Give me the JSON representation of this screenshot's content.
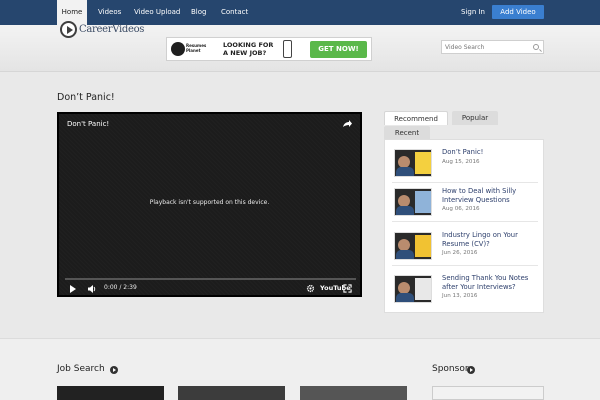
{
  "nav": {
    "items": [
      {
        "label": "Home",
        "active": true
      },
      {
        "label": "Videos",
        "active": false
      },
      {
        "label": "Video Upload",
        "active": false
      },
      {
        "label": "Blog",
        "active": false
      },
      {
        "label": "Contact",
        "active": false
      }
    ],
    "sign_in": "Sign In",
    "add_video": "Add Video"
  },
  "header": {
    "logo_text": "CareerVideos",
    "search_placeholder": "Video Search",
    "ad": {
      "brand": "Resumes Planet",
      "headline": "LOOKING FOR A NEW JOB?",
      "cta": "GET NOW!"
    }
  },
  "main": {
    "page_title": "Don’t Panic!",
    "player": {
      "title": "Don't Panic!",
      "message": "Playback isn't supported on this device.",
      "time": "0:00 / 2:39",
      "progress": 0,
      "logo": "YouTube"
    }
  },
  "sidebar": {
    "tabs": [
      {
        "label": "Recommend",
        "active": true
      },
      {
        "label": "Popular",
        "active": false
      },
      {
        "label": "Recent",
        "active": false
      }
    ],
    "items": [
      {
        "title": "Don’t Panic!",
        "date": "Aug 15, 2016"
      },
      {
        "title": "How to Deal with Silly Interview Questions",
        "date": "Aug 06, 2016"
      },
      {
        "title": "Industry Lingo on Your Resume (CV)?",
        "date": "Jun 26, 2016"
      },
      {
        "title": "Sending Thank You Notes after Your Interviews?",
        "date": "Jun 13, 2016"
      }
    ]
  },
  "bottom": {
    "job_search_title": "Job Search",
    "sponsor_title": "Sponsor"
  }
}
